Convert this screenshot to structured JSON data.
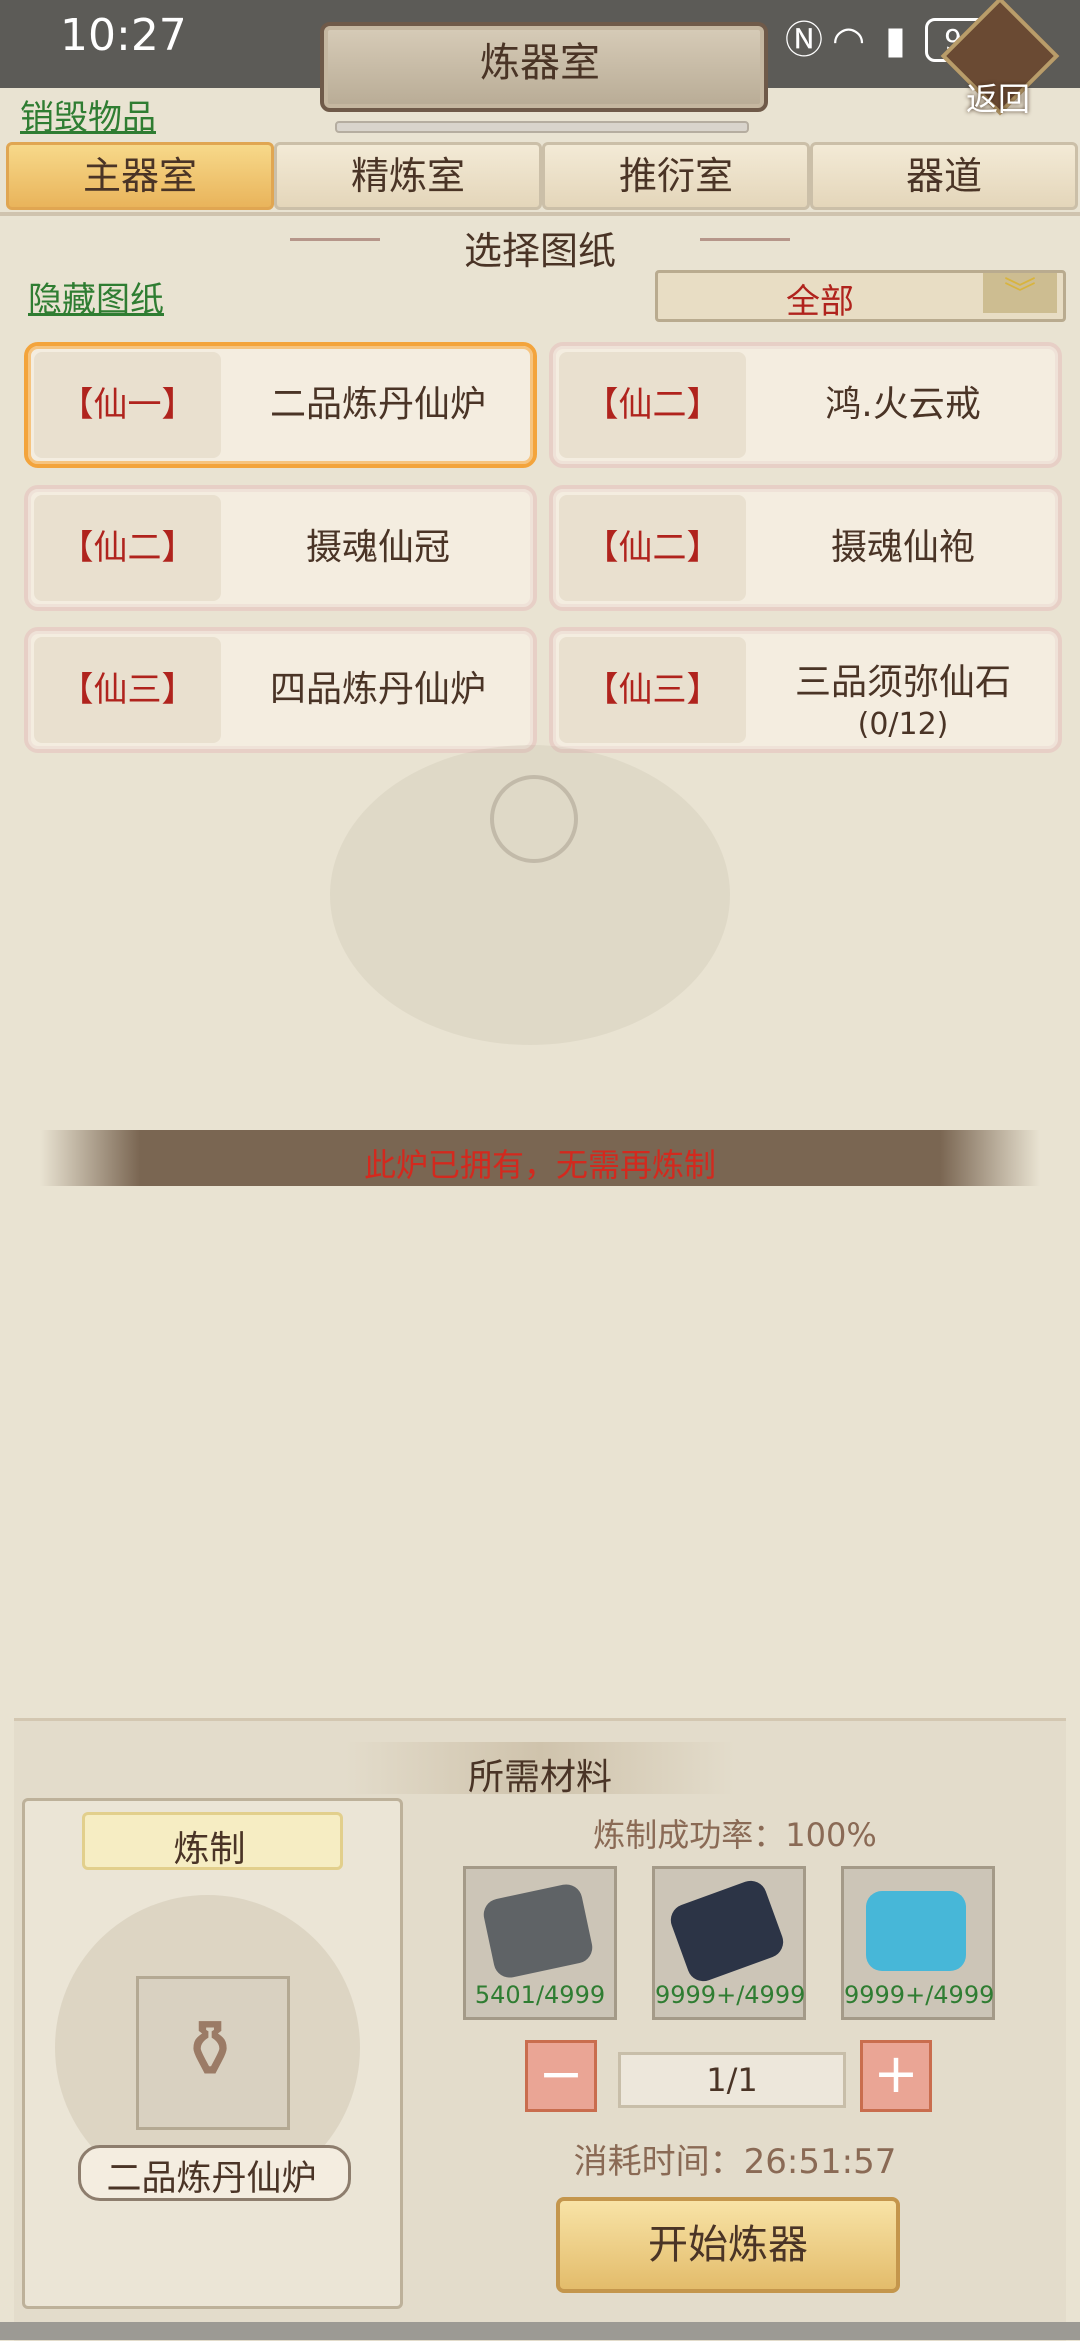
{
  "status_bar": {
    "time": "10:27",
    "battery": "94"
  },
  "header": {
    "title": "炼器室",
    "back_label": "返回",
    "destroy_link": "销毁物品"
  },
  "tabs": [
    {
      "label": "主器室",
      "active": true
    },
    {
      "label": "精炼室",
      "active": false
    },
    {
      "label": "推衍室",
      "active": false
    },
    {
      "label": "器道",
      "active": false
    }
  ],
  "blueprints": {
    "section_title": "选择图纸",
    "hide_link": "隐藏图纸",
    "filter_value": "全部",
    "items": [
      {
        "grade": "【仙一】",
        "name": "二品炼丹仙炉",
        "sub": "",
        "selected": true
      },
      {
        "grade": "【仙二】",
        "name": "鸿.火云戒",
        "sub": "",
        "selected": false
      },
      {
        "grade": "【仙二】",
        "name": "摄魂仙冠",
        "sub": "",
        "selected": false
      },
      {
        "grade": "【仙二】",
        "name": "摄魂仙袍",
        "sub": "",
        "selected": false
      },
      {
        "grade": "【仙三】",
        "name": "四品炼丹仙炉",
        "sub": "",
        "selected": false
      },
      {
        "grade": "【仙三】",
        "name": "三品须弥仙石",
        "sub": "(0/12)",
        "selected": false
      }
    ]
  },
  "message": "此炉已拥有，无需再炼制",
  "materials": {
    "title": "所需材料",
    "craft_title": "炼制",
    "item_name": "二品炼丹仙炉",
    "success_rate": "炼制成功率：100%",
    "items": [
      {
        "count": "5401/4999",
        "icon": "grey-ore-icon",
        "color": "#5f6366"
      },
      {
        "count": "9999+/4999",
        "icon": "dark-crystal-icon",
        "color": "#2c3446"
      },
      {
        "count": "9999+/4999",
        "icon": "blue-crystal-icon",
        "color": "#47b7d8"
      }
    ],
    "quantity": "1/1",
    "time": "消耗时间：26:51:57",
    "start_button": "开始炼器"
  }
}
